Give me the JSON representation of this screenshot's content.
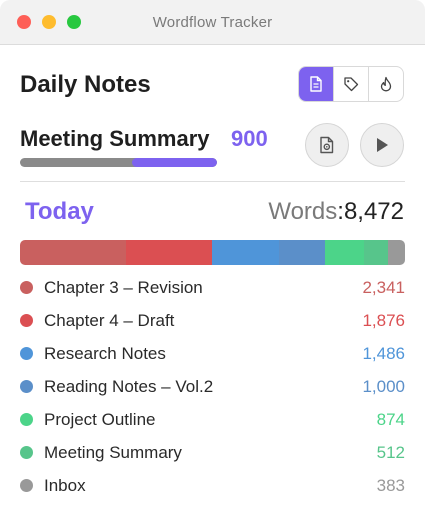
{
  "window": {
    "title": "Wordflow Tracker"
  },
  "header": {
    "title": "Daily Notes"
  },
  "view_switcher": {
    "items": [
      {
        "name": "document-icon",
        "active": true
      },
      {
        "name": "tag-icon",
        "active": false
      },
      {
        "name": "flame-icon",
        "active": false
      }
    ]
  },
  "current_doc": {
    "title": "Meeting Summary",
    "count": "900",
    "progress_fraction": 0.43
  },
  "summary": {
    "period": "Today",
    "words_label": "Words",
    "separator": ":",
    "words_total": "8,472"
  },
  "items": [
    {
      "name": "Chapter 3 – Revision",
      "value": "2,341",
      "count": 2341,
      "color": "#c9605f"
    },
    {
      "name": "Chapter 4 – Draft",
      "value": "1,876",
      "count": 1876,
      "color": "#db4f52"
    },
    {
      "name": "Research Notes",
      "value": "1,486",
      "count": 1486,
      "color": "#4f95d9"
    },
    {
      "name": "Reading Notes – Vol.2",
      "value": "1,000",
      "count": 1000,
      "color": "#5b8fc9"
    },
    {
      "name": "Project Outline",
      "value": "874",
      "count": 874,
      "color": "#4cd489"
    },
    {
      "name": "Meeting Summary",
      "value": "512",
      "count": 512,
      "color": "#57c58b"
    },
    {
      "name": "Inbox",
      "value": "383",
      "count": 383,
      "color": "#999999"
    }
  ]
}
